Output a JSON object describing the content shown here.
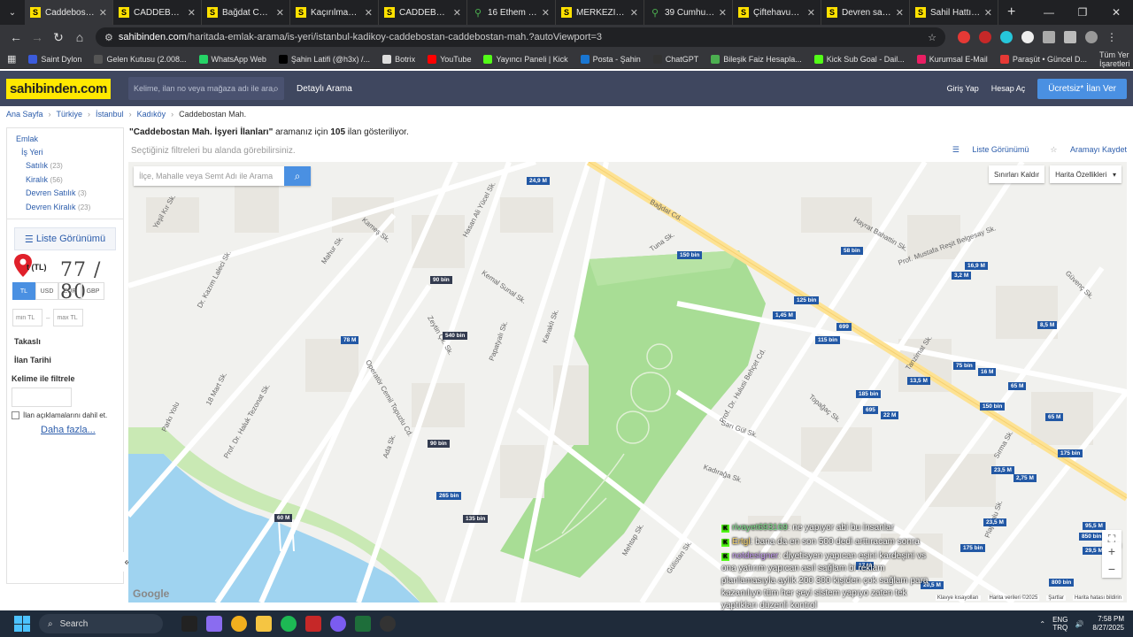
{
  "browser": {
    "tabs": [
      {
        "label": "Caddebostan M",
        "icon": "S",
        "active": true
      },
      {
        "label": "CADDEBOSTAN",
        "icon": "S"
      },
      {
        "label": "Bağdat Cadde",
        "icon": "S"
      },
      {
        "label": "Kaçırılmayacak",
        "icon": "S"
      },
      {
        "label": "CADDEBOSTAN",
        "icon": "S"
      },
      {
        "label": "16 Ethem Efen",
        "icon": "pin"
      },
      {
        "label": "MERKEZİ KONU",
        "icon": "S"
      },
      {
        "label": "39 Cumhuriyet",
        "icon": "pin"
      },
      {
        "label": "Çiftehavuzlar S",
        "icon": "S"
      },
      {
        "label": "Devren satılık",
        "icon": "S"
      },
      {
        "label": "Sahil Hattı Çol",
        "icon": "S"
      }
    ],
    "url_domain": "sahibinden.com",
    "url_path": "/haritada-emlak-arama/is-yeri/istanbul-kadikoy-caddebostan-caddebostan-mah.?autoViewport=3",
    "bookmarks": [
      "Saint Dylon",
      "Gelen Kutusu (2.008...",
      "WhatsApp Web",
      "Şahin Latifi (@h3x) /...",
      "Botrix",
      "YouTube",
      "Yayıncı Paneli | Kick",
      "Posta - Şahin",
      "ChatGPT",
      "Bileşik Faiz Hesapla...",
      "Kick Sub Goal - Dail...",
      "Kurumsal E-Mail",
      "Paraşüt • Güncel D..."
    ],
    "bookmarks_all": "Tüm Yer İşaretleri"
  },
  "header": {
    "logo": "sahibinden.com",
    "search_placeholder": "Kelime, ilan no veya mağaza adı ile ara",
    "detailed_search": "Detaylı Arama",
    "login": "Giriş Yap",
    "signup": "Hesap Aç",
    "cta": "Ücretsiz* İlan Ver"
  },
  "breadcrumb": [
    "Ana Sayfa",
    "Türkiye",
    "İstanbul",
    "Kadıköy",
    "Caddebostan Mah."
  ],
  "sidebar": {
    "root": "Emlak",
    "sub": "İş Yeri",
    "items": [
      {
        "label": "Satılık",
        "count": "(23)"
      },
      {
        "label": "Kiralık",
        "count": "(56)"
      },
      {
        "label": "Devren Satılık",
        "count": "(3)"
      },
      {
        "label": "Devren Kiralık",
        "count": "(23)"
      }
    ],
    "list_view": "Liste Görünümü",
    "price_label": "t (TL)",
    "counter": "77 / 80",
    "currencies": [
      "TL",
      "USD",
      "EUR",
      "GBP"
    ],
    "min_placeholder": "min TL",
    "max_placeholder": "max TL",
    "takasli": "Takaslı",
    "ilan_tarihi": "İlan Tarihi",
    "keyword_filter": "Kelime ile filtrele",
    "include_desc": "İlan açıklamalarını dahil et.",
    "more": "Daha fazla..."
  },
  "result": {
    "query": "\"Caddebostan Mah. İşyeri İlanları\"",
    "middle": " aramanız için ",
    "count": "105",
    "suffix": " ilan gösteriliyor.",
    "sub": "Seçtiğiniz filtreleri bu alanda görebilirsiniz.",
    "list_view": "Liste Görünümü",
    "save_search": "Aramayı Kaydet"
  },
  "map": {
    "search_placeholder": "İlçe, Mahalle veya Semt Adı ile Arama",
    "remove_bounds": "Sınırları Kaldır",
    "map_features": "Harita Özellikleri",
    "google": "Google",
    "footer": [
      "Klavye kısayolları",
      "Harita verileri ©2025",
      "Şartlar",
      "Harita hatası bildirin"
    ],
    "streets": [
      {
        "text": "Hasan Ali Yücel Sk."
      },
      {
        "text": "Kameş Sk."
      },
      {
        "text": "Mahur Sk."
      },
      {
        "text": "Yeşil Kır Sk."
      },
      {
        "text": "Dr. Kazım Laleci Sk."
      },
      {
        "text": "18 Mart Sk."
      },
      {
        "text": "Operatör Cemil Topuzlu Cd."
      },
      {
        "text": "Kemal Sunal Sk."
      },
      {
        "text": "Zeytin Çk. Sk."
      },
      {
        "text": "Papatyalı Sk."
      },
      {
        "text": "Kavaklı Sk."
      },
      {
        "text": "Prof. Dr. Haluk Tezonat Sk."
      },
      {
        "text": "Bağdat Cd."
      },
      {
        "text": "Hayrat Bahattin Sk."
      },
      {
        "text": "Tuna Sk."
      },
      {
        "text": "Prof. Dr. Hulusi Behçet Cd."
      },
      {
        "text": "Topağaç Sk."
      },
      {
        "text": "Sarı Gül Sk."
      },
      {
        "text": "Kadırağa Sk."
      },
      {
        "text": "Tanzimat Sk."
      },
      {
        "text": "Sırma Sk."
      },
      {
        "text": "Ada Sk."
      },
      {
        "text": "Parkı Yolu"
      },
      {
        "text": "Gülistan Sk."
      },
      {
        "text": "Mehtap Sk."
      },
      {
        "text": "Plaj Yolu Sk."
      },
      {
        "text": "Güvenç Sk."
      },
      {
        "text": "Prof. Mustafa Reşit Belgesay Sk."
      }
    ],
    "price_tags": [
      "24,9 M",
      "150 bin",
      "58 bin",
      "16,9 M",
      "3,2 M",
      "90 bin",
      "125 bin",
      "1,45 M",
      "699",
      "540 bin",
      "78 M",
      "115 bin",
      "8,5 M",
      "75 bin",
      "16 M",
      "13,5 M",
      "65 M",
      "185 bin",
      "150 bin",
      "695",
      "22 M",
      "65 M",
      "90 bin",
      "175 bin",
      "265 bin",
      "23,5 M",
      "2,75 M",
      "60 M",
      "135 bin",
      "23,5 M",
      "95,5 M",
      "850 bin",
      "175 bin",
      "29,5 M",
      "17 M",
      "20,5 M",
      "800 bin"
    ]
  },
  "chat": [
    {
      "user": "rivayet693169",
      "text": ": ne yapıyor abi bu insanlar"
    },
    {
      "user": "Ertgl",
      "text": ": bana da en son 500 dedi arttıracam sonra"
    },
    {
      "user": "notdesigner",
      "text": ": diyetisyen yapıcan eşini kardeşini vs ona yatırım yapıcan asıl sağlam bi reklam planlamasıyla aylık 200 300 kişiden çok sağlam para kazanılıyo tüm her şeyi sistem yapıyo zaten tek yaptıkları düzenli kontrol"
    }
  ],
  "taskbar": {
    "search": "Search",
    "lang1": "ENG",
    "lang2": "TRQ",
    "time": "7:58 PM",
    "date": "8/27/2025"
  }
}
